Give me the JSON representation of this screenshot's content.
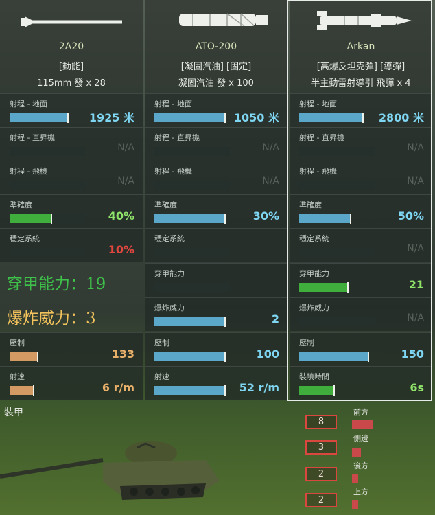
{
  "weapons": [
    {
      "name": "2A20",
      "type": "[動能]",
      "ammo": "115mm 發 x 28",
      "image_icon": "cannon-shell-icon",
      "stats": {
        "range_ground": {
          "label": "射程 - 地面",
          "value": "1925 米",
          "fill": 0.42
        },
        "range_heli": {
          "label": "射程 - 直昇機",
          "value": "N/A"
        },
        "range_plane": {
          "label": "射程 - 飛機",
          "value": "N/A"
        },
        "accuracy": {
          "label": "準確度",
          "value": "40%",
          "fill": 0.3
        },
        "stabilizer": {
          "label": "穩定系統",
          "value": "10%",
          "fill": 0
        }
      },
      "penetration": {
        "label": "穿甲能力：",
        "value": "19"
      },
      "explosive": {
        "label": "爆炸威力：",
        "value": "3"
      },
      "suppression": {
        "label": "壓制",
        "value": "133",
        "fill": 0.2
      },
      "rate": {
        "label": "射速",
        "value": "6 r/m",
        "fill": 0.17
      }
    },
    {
      "name": "ATO-200",
      "type": "[凝固汽油] [固定]",
      "ammo": "凝固汽油 發 x 100",
      "image_icon": "flamethrower-icon",
      "stats": {
        "range_ground": {
          "label": "射程 - 地面",
          "value": "1050 米",
          "fill": 0.53
        },
        "range_heli": {
          "label": "射程 - 直昇機",
          "value": "N/A"
        },
        "range_plane": {
          "label": "射程 - 飛機",
          "value": "N/A"
        },
        "accuracy": {
          "label": "準確度",
          "value": "30%",
          "fill": 0.53
        },
        "stabilizer": {
          "label": "穩定系統",
          "value": ""
        },
        "penetration": {
          "label": "穿甲能力",
          "value": ""
        },
        "explosive": {
          "label": "爆炸威力",
          "value": "2",
          "fill": 0.53
        }
      },
      "suppression": {
        "label": "壓制",
        "value": "100",
        "fill": 0.53
      },
      "rate": {
        "label": "射速",
        "value": "52 r/m",
        "fill": 0.53
      }
    },
    {
      "name": "Arkan",
      "type": "[高爆反坦克彈] [導彈]",
      "ammo": "半主動雷射導引 飛彈 x 4",
      "image_icon": "missile-icon",
      "stats": {
        "range_ground": {
          "label": "射程 - 地面",
          "value": "2800 米",
          "fill": 0.48
        },
        "range_heli": {
          "label": "射程 - 直昇機",
          "value": "N/A"
        },
        "range_plane": {
          "label": "射程 - 飛機",
          "value": "N/A"
        },
        "accuracy": {
          "label": "準確度",
          "value": "50%",
          "fill": 0.38
        },
        "stabilizer": {
          "label": "穩定系統",
          "value": "N/A"
        },
        "penetration": {
          "label": "穿甲能力",
          "value": "21",
          "fill": 0.35
        },
        "explosive": {
          "label": "爆炸威力",
          "value": "N/A"
        }
      },
      "suppression": {
        "label": "壓制",
        "value": "150",
        "fill": 0.5
      },
      "reload": {
        "label": "裝填時間",
        "value": "6s",
        "fill": 0.25
      }
    }
  ],
  "armor": {
    "title": "裝甲",
    "items": [
      {
        "value": "8",
        "label": "前方",
        "fill": 1.0
      },
      {
        "value": "3",
        "label": "側邊",
        "fill": 0.45
      },
      {
        "value": "2",
        "label": "後方",
        "fill": 0.3
      },
      {
        "value": "2",
        "label": "上方",
        "fill": 0.3
      }
    ]
  },
  "colors": {
    "blue_bar": "#5aa7c9",
    "green_bar": "#3fae3c",
    "orange_bar": "#d39a63",
    "blue_text": "#7fd6f2",
    "green_text": "#8fe36a",
    "orange_text": "#e9b06a",
    "red_text": "#e2473f",
    "armor_red": "#c9484a"
  }
}
